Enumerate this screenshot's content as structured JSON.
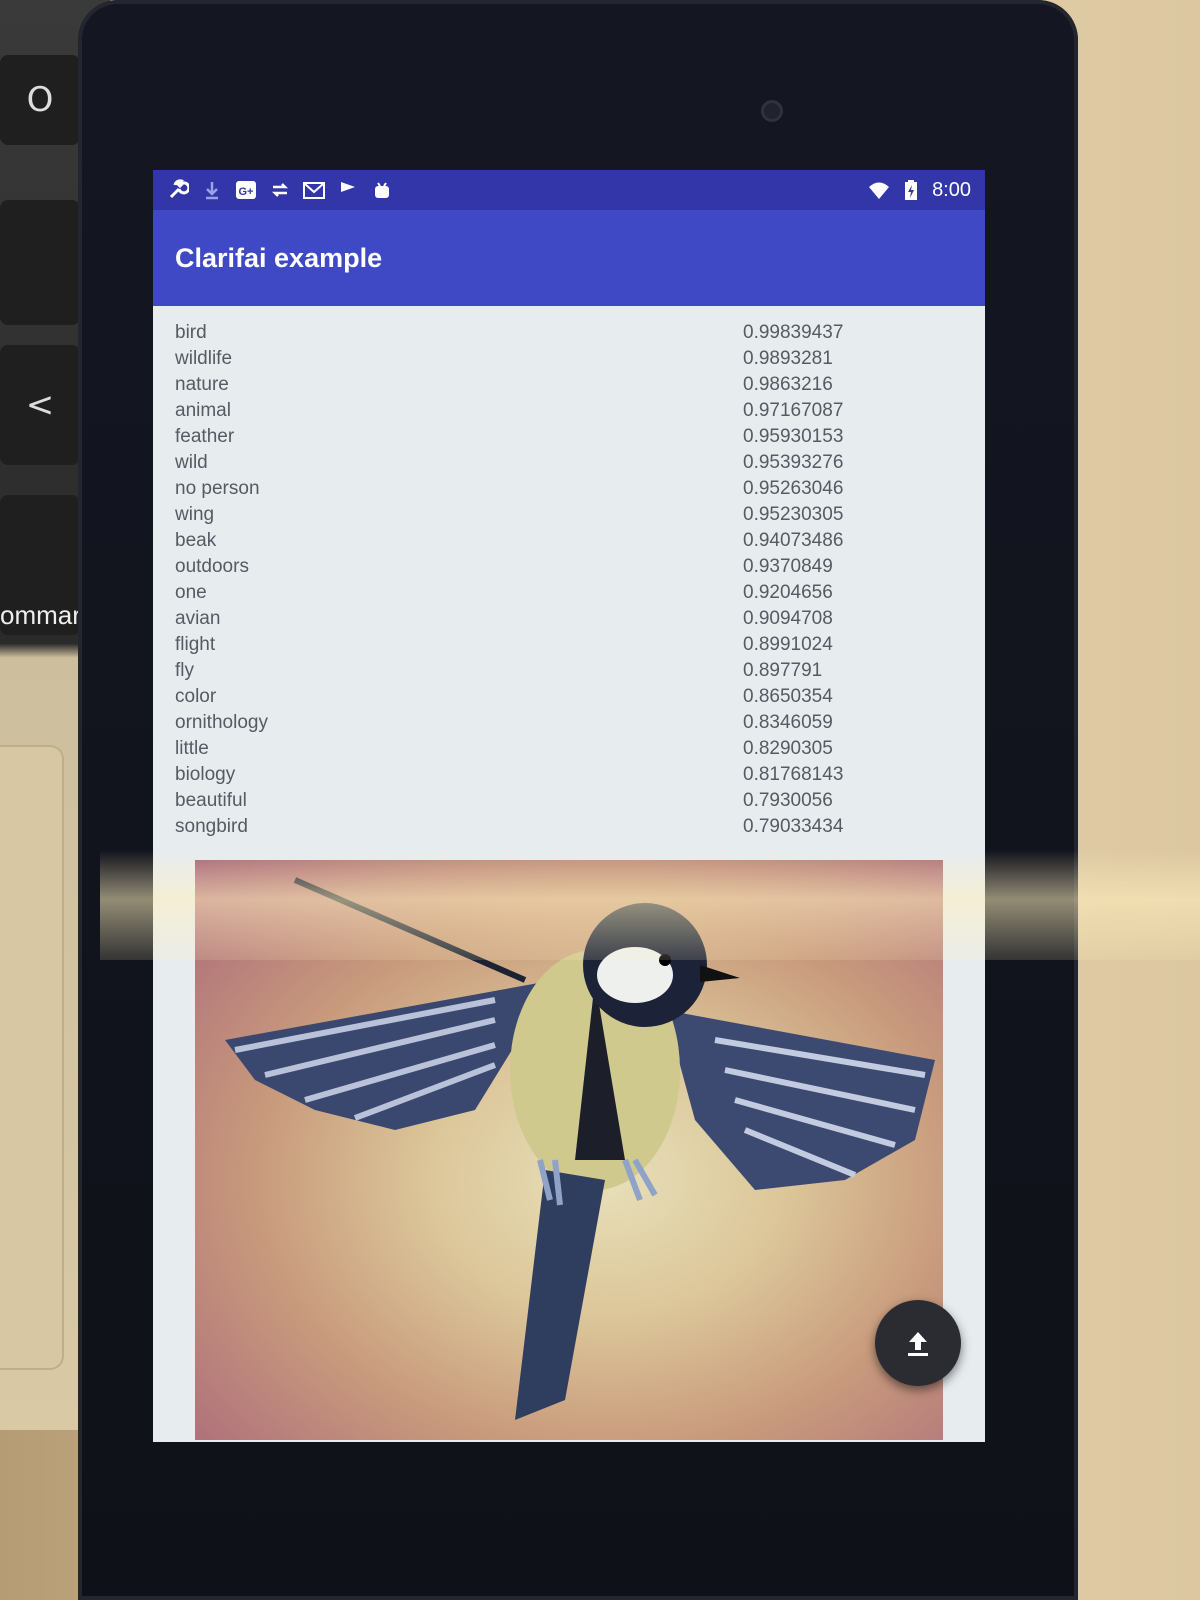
{
  "laptop": {
    "keys": [
      "O",
      "<",
      "′",
      "⌘"
    ],
    "label": "ommar"
  },
  "status_bar": {
    "time": "8:00",
    "left_icons": [
      "wrench-icon",
      "download-icon",
      "google-plus-icon",
      "sync-icon",
      "gmail-icon",
      "flag-icon",
      "android-icon"
    ],
    "right_icons": [
      "wifi-icon",
      "battery-charging-icon"
    ]
  },
  "app_bar": {
    "title": "Clarifai example"
  },
  "results": [
    {
      "label": "bird",
      "score": "0.99839437"
    },
    {
      "label": "wildlife",
      "score": "0.9893281"
    },
    {
      "label": "nature",
      "score": "0.9863216"
    },
    {
      "label": "animal",
      "score": "0.97167087"
    },
    {
      "label": "feather",
      "score": "0.95930153"
    },
    {
      "label": "wild",
      "score": "0.95393276"
    },
    {
      "label": "no person",
      "score": "0.95263046"
    },
    {
      "label": "wing",
      "score": "0.95230305"
    },
    {
      "label": "beak",
      "score": "0.94073486"
    },
    {
      "label": "outdoors",
      "score": "0.9370849"
    },
    {
      "label": "one",
      "score": "0.9204656"
    },
    {
      "label": "avian",
      "score": "0.9094708"
    },
    {
      "label": "flight",
      "score": "0.8991024"
    },
    {
      "label": "fly",
      "score": "0.897791"
    },
    {
      "label": "color",
      "score": "0.8650354"
    },
    {
      "label": "ornithology",
      "score": "0.8346059"
    },
    {
      "label": "little",
      "score": "0.8290305"
    },
    {
      "label": "biology",
      "score": "0.81768143"
    },
    {
      "label": "beautiful",
      "score": "0.7930056"
    },
    {
      "label": "songbird",
      "score": "0.79033434"
    }
  ],
  "fab": {
    "icon": "upload-icon"
  },
  "nav_bar": {
    "icons": [
      "back-icon",
      "home-icon",
      "recents-icon"
    ]
  },
  "colors": {
    "status_bar": "#3236a8",
    "app_bar": "#3f49c6",
    "content_bg": "#e7ecef",
    "fab": "#2b2c31"
  }
}
